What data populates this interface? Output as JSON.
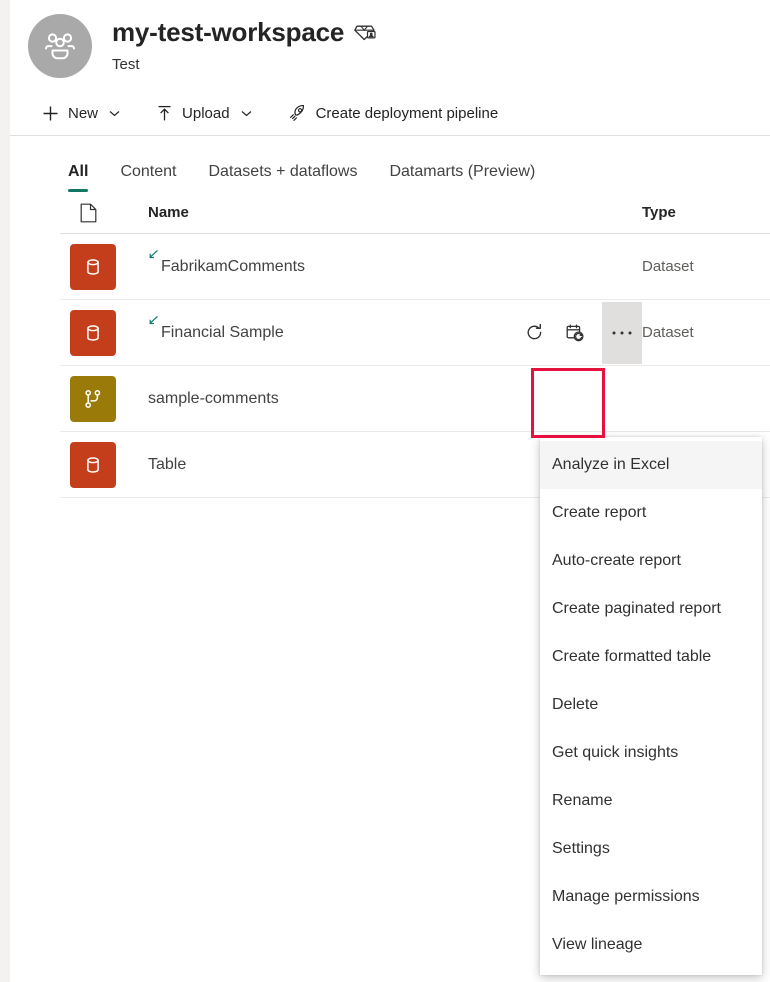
{
  "workspace": {
    "avatar_icon": "people-group-icon",
    "title": "my-test-workspace",
    "premium_icon": "premium-capacity-diamond-icon",
    "subtitle": "Test"
  },
  "toolbar": {
    "new_label": "New",
    "new_icon": "plus-icon",
    "new_caret_icon": "chevron-down-icon",
    "upload_label": "Upload",
    "upload_icon": "upload-arrow-icon",
    "upload_caret_icon": "chevron-down-icon",
    "pipeline_label": "Create deployment pipeline",
    "pipeline_icon": "rocket-icon"
  },
  "tabs": [
    {
      "label": "All",
      "active": true
    },
    {
      "label": "Content",
      "active": false
    },
    {
      "label": "Datasets + dataflows",
      "active": false
    },
    {
      "label": "Datamarts (Preview)",
      "active": false
    }
  ],
  "list": {
    "columns": {
      "icon_header": "page-icon",
      "name": "Name",
      "type": "Type"
    },
    "rows": [
      {
        "name": "FabrikamComments",
        "type": "Dataset",
        "icon": "dataset-icon",
        "icon_color": "#C43E1C",
        "endorsed": true,
        "endorse_icon": "promoted-arrow-icon",
        "hovered": false
      },
      {
        "name": "Financial Sample",
        "type": "Dataset",
        "icon": "dataset-icon",
        "icon_color": "#C43E1C",
        "endorsed": true,
        "endorse_icon": "promoted-arrow-icon",
        "hovered": true,
        "actions": {
          "refresh_icon": "refresh-now-icon",
          "schedule_icon": "schedule-refresh-icon",
          "more_icon": "more-options-icon",
          "more_label": "..."
        }
      },
      {
        "name": "sample-comments",
        "type": "",
        "icon": "dataflow-icon",
        "icon_color": "#9A7B0A",
        "endorsed": false,
        "hovered": false
      },
      {
        "name": "Table",
        "type": "",
        "icon": "dataset-icon",
        "icon_color": "#C43E1C",
        "endorsed": false,
        "hovered": false
      }
    ]
  },
  "context_menu": {
    "items": [
      {
        "label": "Analyze in Excel",
        "highlighted": true
      },
      {
        "label": "Create report",
        "highlighted": false
      },
      {
        "label": "Auto-create report",
        "highlighted": false
      },
      {
        "label": "Create paginated report",
        "highlighted": false
      },
      {
        "label": "Create formatted table",
        "highlighted": false
      },
      {
        "label": "Delete",
        "highlighted": false
      },
      {
        "label": "Get quick insights",
        "highlighted": false
      },
      {
        "label": "Rename",
        "highlighted": false
      },
      {
        "label": "Settings",
        "highlighted": false
      },
      {
        "label": "Manage permissions",
        "highlighted": false
      },
      {
        "label": "View lineage",
        "highlighted": false
      }
    ]
  },
  "annotation": {
    "type": "red-highlight-box",
    "target": "more-options-button",
    "color": "#E6123D"
  }
}
